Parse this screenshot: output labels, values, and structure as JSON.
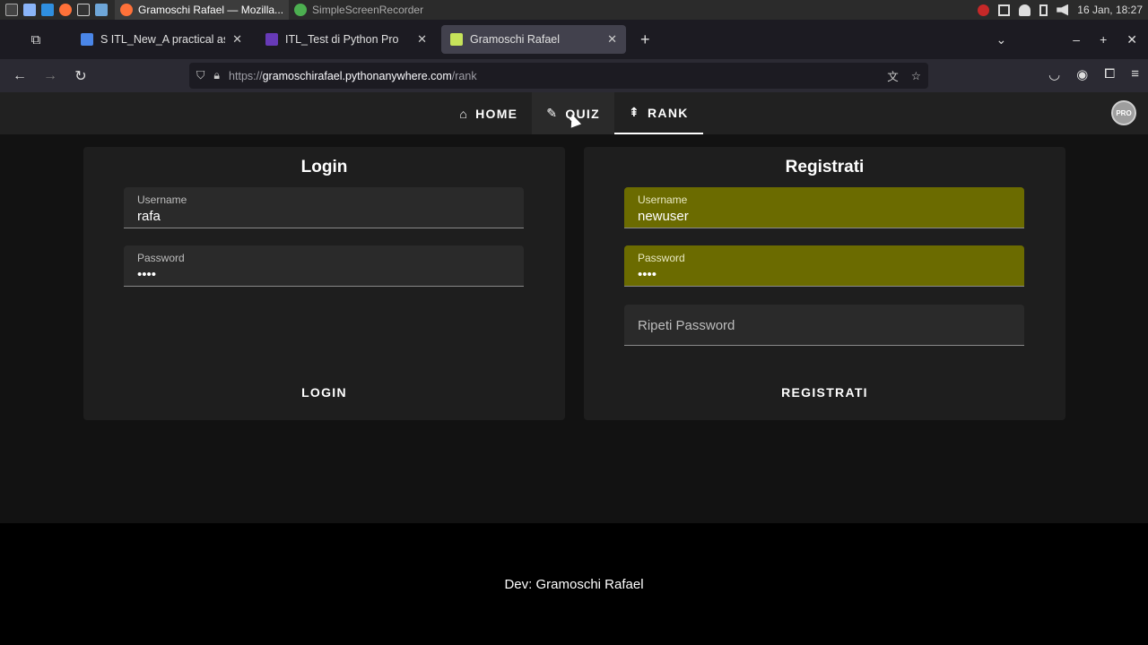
{
  "taskbar": {
    "tasks": [
      {
        "label": "Gramoschi Rafael — Mozilla...",
        "active": true
      },
      {
        "label": "SimpleScreenRecorder",
        "active": false
      }
    ],
    "clock": "16 Jan, 18:27"
  },
  "browser": {
    "tabs": [
      {
        "title": "S ITL_New_A practical assignr",
        "favicon_color": "#4a86e8",
        "favicon": "docs-icon"
      },
      {
        "title": "ITL_Test di Python Pro",
        "favicon_color": "#673ab7",
        "favicon": "forms-icon"
      },
      {
        "title": "Gramoschi Rafael",
        "favicon_color": "#c6e35a",
        "favicon": "k-icon",
        "active": true
      }
    ],
    "url": {
      "scheme": "https://",
      "host": "gramoschirafael.pythonanywhere.com",
      "path": "/rank"
    }
  },
  "app": {
    "nav": [
      {
        "label": "HOME",
        "icon": "home-icon"
      },
      {
        "label": "QUIZ",
        "icon": "pencil-icon"
      },
      {
        "label": "RANK",
        "icon": "rank-icon"
      }
    ],
    "avatar_text": "PRO",
    "login": {
      "title": "Login",
      "username_label": "Username",
      "username_value": "rafa",
      "password_label": "Password",
      "password_value": "••••",
      "button": "LOGIN"
    },
    "register": {
      "title": "Registrati",
      "username_label": "Username",
      "username_value": "newuser",
      "password_label": "Password",
      "password_value": "••••",
      "repeat_placeholder": "Ripeti Password",
      "button": "REGISTRATI"
    },
    "footer": "Dev: Gramoschi Rafael",
    "colors": {
      "autofill": "#6b6b00",
      "card": "#1e1e1e",
      "appbar": "#212121"
    }
  }
}
